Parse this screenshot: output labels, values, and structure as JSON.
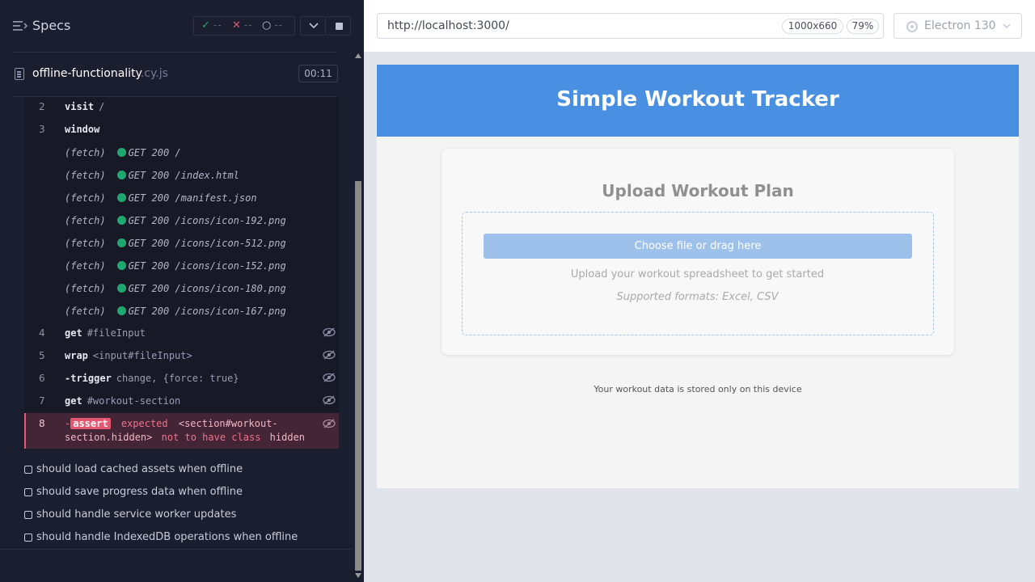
{
  "reporter": {
    "specs_label": "Specs",
    "stats": {
      "passed": "--",
      "failed": "--",
      "pending": "--"
    },
    "spec_file": {
      "name": "offline-functionality",
      "ext": ".cy.js",
      "duration": "00:11"
    },
    "commands": [
      {
        "num": "2",
        "name": "visit",
        "message": "/"
      },
      {
        "num": "3",
        "name": "window",
        "message": ""
      }
    ],
    "fetches": [
      {
        "label": "(fetch)",
        "method": "GET",
        "status": "200",
        "url": "/"
      },
      {
        "label": "(fetch)",
        "method": "GET",
        "status": "200",
        "url": "/index.html"
      },
      {
        "label": "(fetch)",
        "method": "GET",
        "status": "200",
        "url": "/manifest.json"
      },
      {
        "label": "(fetch)",
        "method": "GET",
        "status": "200",
        "url": "/icons/icon-192.png"
      },
      {
        "label": "(fetch)",
        "method": "GET",
        "status": "200",
        "url": "/icons/icon-512.png"
      },
      {
        "label": "(fetch)",
        "method": "GET",
        "status": "200",
        "url": "/icons/icon-152.png"
      },
      {
        "label": "(fetch)",
        "method": "GET",
        "status": "200",
        "url": "/icons/icon-180.png"
      },
      {
        "label": "(fetch)",
        "method": "GET",
        "status": "200",
        "url": "/icons/icon-167.png"
      }
    ],
    "commands2": [
      {
        "num": "4",
        "name": "get",
        "message": "#fileInput"
      },
      {
        "num": "5",
        "name": "wrap",
        "message": "<input#fileInput>"
      },
      {
        "num": "6",
        "name": "-trigger",
        "message": "change, {force: true}"
      },
      {
        "num": "7",
        "name": "get",
        "message": "#workout-section"
      }
    ],
    "failed_command": {
      "num": "8",
      "prefix": "-",
      "name": "assert",
      "expected": "expected",
      "subject_line1": "<section#workout-",
      "subject_line2": "section.hidden>",
      "not_to_have": "not to have class",
      "value": "hidden"
    },
    "pending_tests": [
      "should load cached assets when offline",
      "should save progress data when offline",
      "should handle service worker updates",
      "should handle IndexedDB operations when offline"
    ]
  },
  "aut": {
    "url": "http://localhost:3000/",
    "viewport": "1000x660",
    "zoom": "79%",
    "browser": "Electron 130"
  },
  "app": {
    "title": "Simple Workout Tracker",
    "card_title": "Upload Workout Plan",
    "choose_button": "Choose file or drag here",
    "upload_hint": "Upload your workout spreadsheet to get started",
    "formats": "Supported formats: Excel, CSV",
    "storage_note": "Your workout data is stored only on this device"
  },
  "colors": {
    "reporter_bg": "#1b1e2e",
    "pass": "#1fa971",
    "fail": "#e45770",
    "app_header": "#4a90e2"
  },
  "icons": {
    "specs": "menu-lines-icon",
    "pass": "check-icon",
    "fail": "x-icon",
    "pending": "circle-notch-icon",
    "file": "document-icon",
    "hidden": "eye-slash-icon",
    "browser": "gear-icon"
  }
}
